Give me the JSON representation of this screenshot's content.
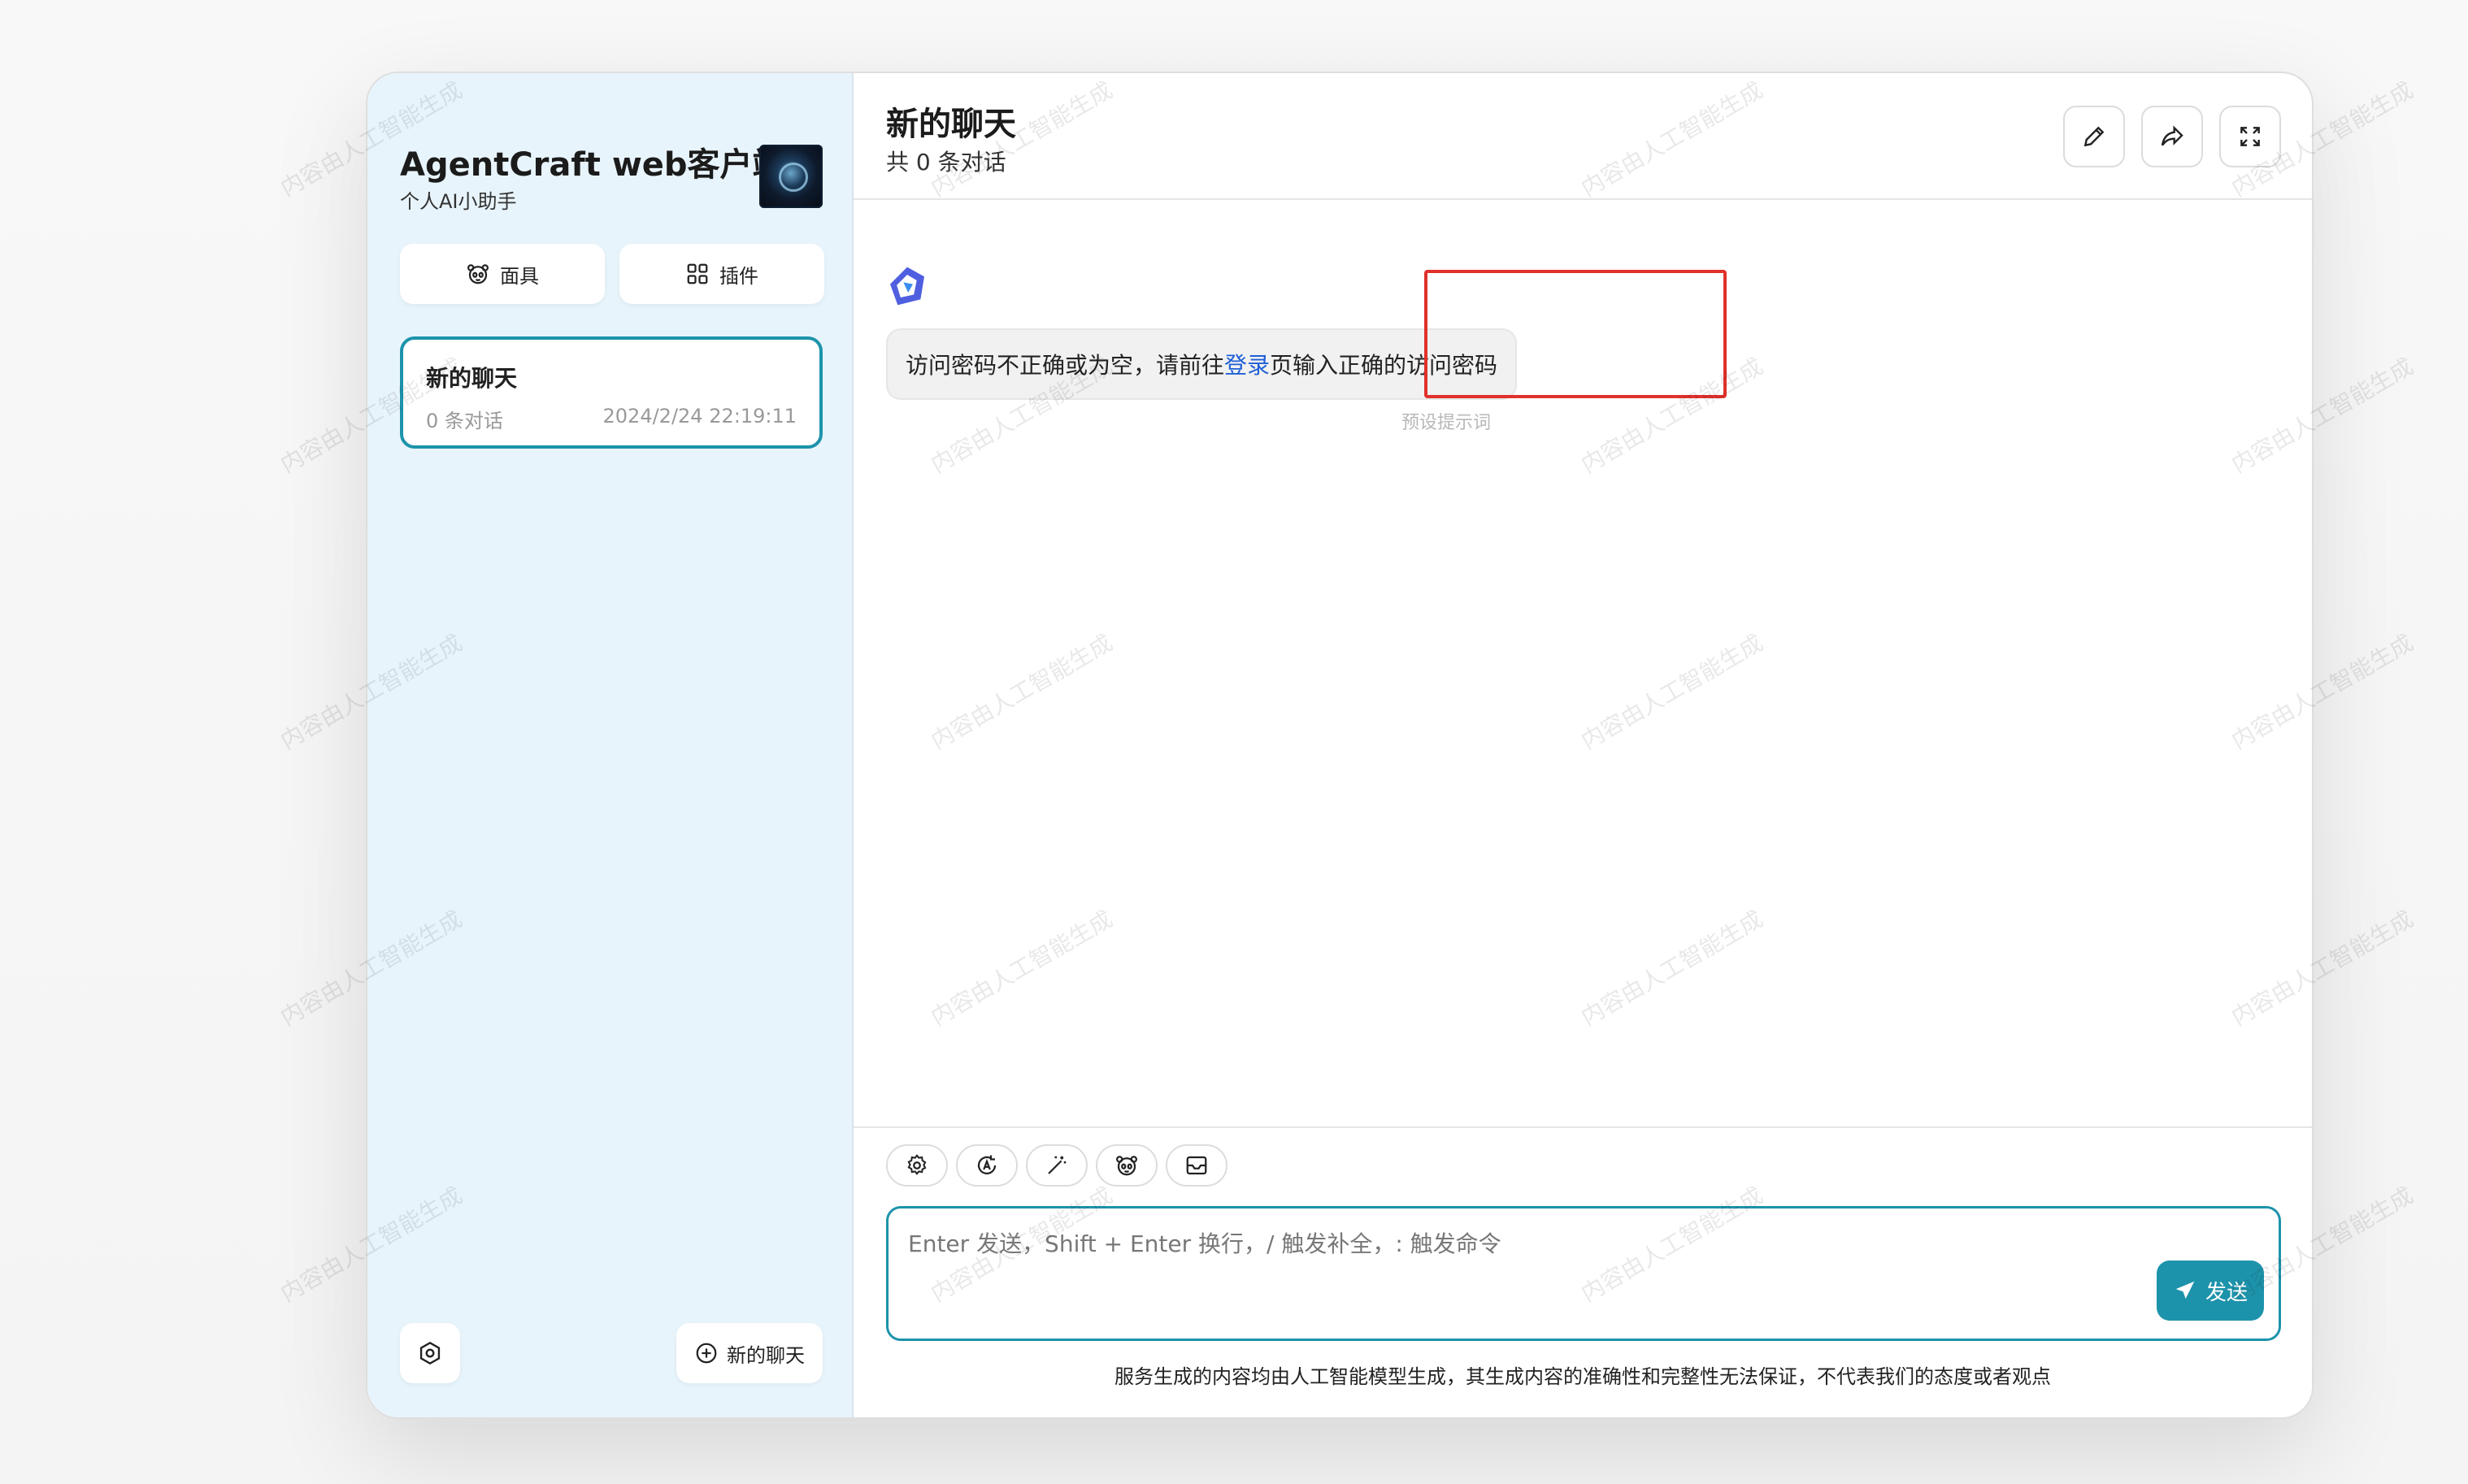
{
  "sidebar": {
    "title": "AgentCraft web客户端",
    "subtitle": "个人AI小助手",
    "mask_button": "面具",
    "plugin_button": "插件",
    "chat_item": {
      "title": "新的聊天",
      "count": "0 条对话",
      "time": "2024/2/24 22:19:11"
    },
    "new_chat_button": "新的聊天"
  },
  "header": {
    "title": "新的聊天",
    "subtitle": "共 0 条对话"
  },
  "message": {
    "text_before": "访问密码不正确或为空，请前往",
    "link_text": "登录",
    "text_after": "页输入正确的访问密码",
    "preset_tag": "预设提示词"
  },
  "input": {
    "placeholder": "Enter 发送，Shift + Enter 换行，/ 触发补全，: 触发命令",
    "send_button": "发送"
  },
  "disclaimer": "服务生成的内容均由人工智能模型生成，其生成内容的准确性和完整性无法保证，不代表我们的态度或者观点",
  "watermark": "内容由人工智能生成",
  "colors": {
    "accent": "#1d93ab",
    "sidebar_bg": "#e8f4fb",
    "link": "#1f5fd6",
    "highlight_box": "#e0312b"
  }
}
